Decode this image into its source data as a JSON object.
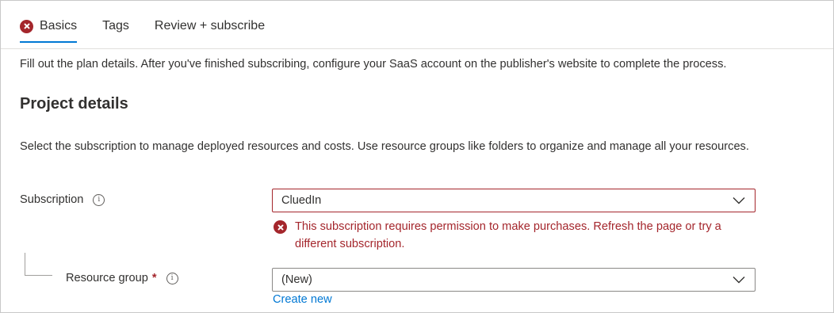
{
  "tabs": [
    {
      "label": "Basics",
      "active": true,
      "has_error": true
    },
    {
      "label": "Tags",
      "active": false,
      "has_error": false
    },
    {
      "label": "Review + subscribe",
      "active": false,
      "has_error": false
    }
  ],
  "intro_text": "Fill out the plan details. After you've finished subscribing, configure your SaaS account on the publisher's website to complete the process.",
  "project_details": {
    "heading": "Project details",
    "description": "Select the subscription to manage deployed resources and costs. Use resource groups like folders to organize and manage all your resources."
  },
  "subscription": {
    "label": "Subscription",
    "info_icon": "info-icon",
    "value": "CluedIn",
    "error_message": "This subscription requires permission to make purchases. Refresh the page or try a different subscription."
  },
  "resource_group": {
    "label": "Resource group",
    "required_marker": "*",
    "info_icon": "info-icon",
    "value": "(New)",
    "create_new_label": "Create new"
  },
  "colors": {
    "accent": "#0078d4",
    "error": "#a4262c",
    "text": "#323130"
  }
}
